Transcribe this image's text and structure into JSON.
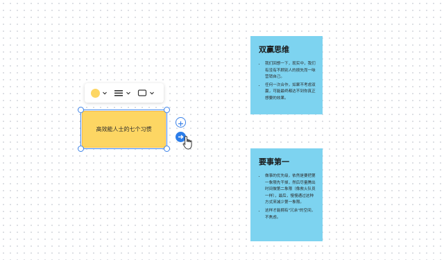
{
  "toolbar": {
    "fill_color": "#fdd663",
    "fill_icon": "color-circle-icon",
    "line_icon": "line-style-icon",
    "shape_icon": "rectangle-shape-icon",
    "chevron_icon": "chevron-down-icon"
  },
  "selected_note": {
    "text": "高效能人士的七个习惯",
    "fill": "#fdd663",
    "selection_color": "#3b82e8"
  },
  "connector_controls": {
    "add_icon": "plus-circle-icon",
    "next_icon": "arrow-right-icon",
    "cursor_icon": "hand-pointer-icon"
  },
  "cards": [
    {
      "title": "双赢思维",
      "color": "#7dd3f0",
      "items": [
        "我们回想一下，现实中，我们有没有不顾别人的损失而一味营销自己。",
        "任何一次合作，如果不考虑双赢，可能最终都达不到你真正想要的效果。"
      ]
    },
    {
      "title": "要事第一",
      "color": "#7dd3f0",
      "items": [
        "做事的优先级，依然是要把第一象限先干掉，然后尽量腾出时间做第二象限（像救火队员一样），最后，慢慢通过这种方式来减少第一象限。",
        "这样才能拥有\"冗余\"的空间，不焦虑。"
      ]
    }
  ]
}
